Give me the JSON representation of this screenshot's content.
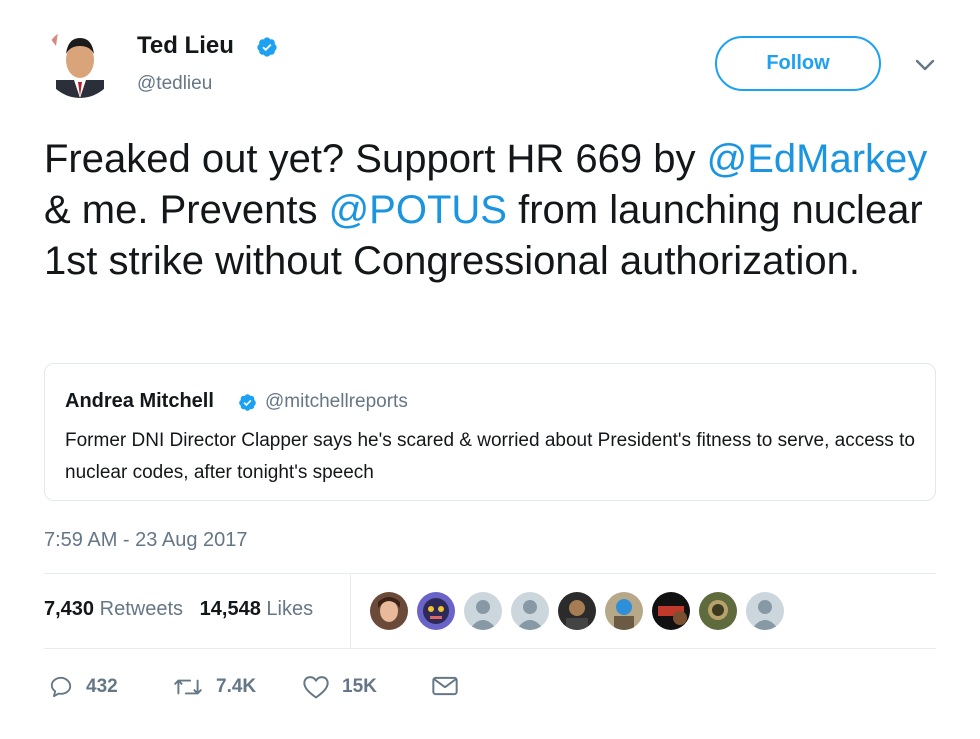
{
  "author": {
    "name": "Ted Lieu",
    "handle": "@tedlieu",
    "verified": true
  },
  "follow_label": "Follow",
  "tweet": {
    "part1": "Freaked out yet? Support HR 669 by ",
    "mention1": "@EdMarkey",
    "part2": " & me. Prevents ",
    "mention2": "@POTUS",
    "part3": " from launching nuclear 1st strike without Congressional authorization."
  },
  "quote": {
    "name": "Andrea Mitchell",
    "handle": "@mitchellreports",
    "text": "Former DNI Director Clapper says he's scared & worried about President's fitness to serve, access to nuclear codes, after tonight's speech"
  },
  "timestamp": "7:59 AM - 23 Aug 2017",
  "stats": {
    "retweets_count": "7,430",
    "retweets_label": "Retweets",
    "likes_count": "14,548",
    "likes_label": "Likes"
  },
  "actions": {
    "replies": "432",
    "retweets": "7.4K",
    "likes": "15K"
  },
  "colors": {
    "accent": "#1da1f2",
    "mention": "#1b95e0",
    "muted": "#657786"
  },
  "icons": [
    "verified-badge-icon",
    "chevron-down-icon",
    "reply-icon",
    "retweet-icon",
    "heart-icon",
    "envelope-icon"
  ]
}
